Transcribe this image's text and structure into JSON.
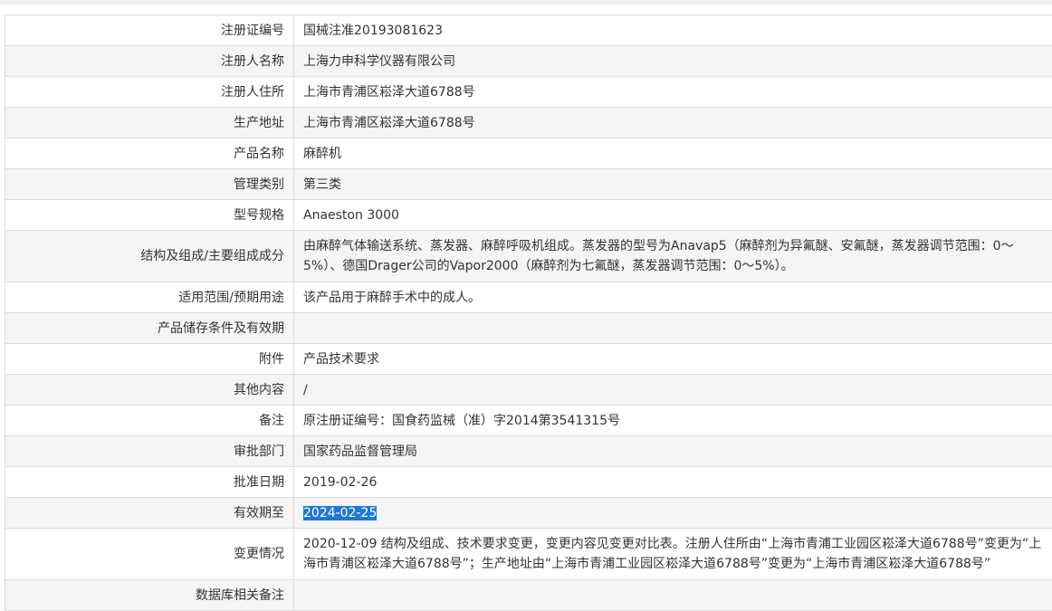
{
  "rows": [
    {
      "label": "注册证编号",
      "value": "国械注准20193081623"
    },
    {
      "label": "注册人名称",
      "value": "上海力申科学仪器有限公司"
    },
    {
      "label": "注册人住所",
      "value": "上海市青浦区崧泽大道6788号"
    },
    {
      "label": "生产地址",
      "value": "上海市青浦区崧泽大道6788号"
    },
    {
      "label": "产品名称",
      "value": "麻醉机"
    },
    {
      "label": "管理类别",
      "value": "第三类"
    },
    {
      "label": "型号规格",
      "value": "Anaeston 3000"
    },
    {
      "label": "结构及组成/主要组成成分",
      "value": "由麻醉气体输送系统、蒸发器、麻醉呼吸机组成。蒸发器的型号为Anavap5（麻醉剂为异氟醚、安氟醚，蒸发器调节范围：0～5%）、德国Drager公司的Vapor2000（麻醉剂为七氟醚，蒸发器调节范围：0～5%）。"
    },
    {
      "label": "适用范围/预期用途",
      "value": "该产品用于麻醉手术中的成人。"
    },
    {
      "label": "产品储存条件及有效期",
      "value": ""
    },
    {
      "label": "附件",
      "value": "产品技术要求"
    },
    {
      "label": "其他内容",
      "value": "/"
    },
    {
      "label": "备注",
      "value": "原注册证编号：国食药监械（准）字2014第3541315号"
    },
    {
      "label": "审批部门",
      "value": "国家药品监督管理局"
    },
    {
      "label": "批准日期",
      "value": "2019-02-26"
    },
    {
      "label": "有效期至",
      "value": "2024-02-25"
    },
    {
      "label": "变更情况",
      "value": "2020-12-09 结构及组成、技术要求变更，变更内容见变更对比表。注册人住所由“上海市青浦工业园区崧泽大道6788号”变更为“上海市青浦区崧泽大道6788号”；生产地址由“上海市青浦工业园区崧泽大道6788号”变更为“上海市青浦区崧泽大道6788号”"
    },
    {
      "label": "数据库相关备注",
      "value": ""
    }
  ],
  "selection": {
    "color": "#1e78d7"
  }
}
